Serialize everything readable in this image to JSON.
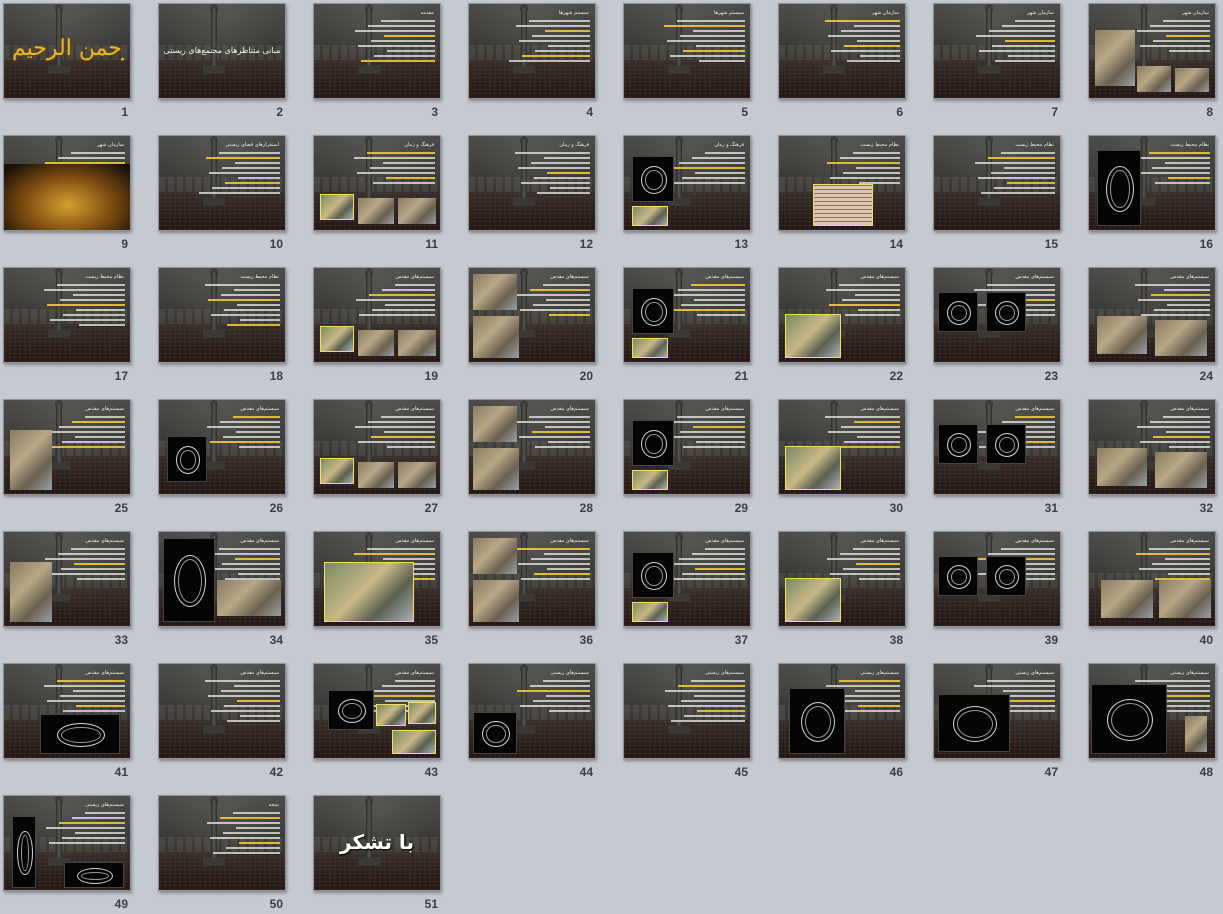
{
  "app": {
    "view": "slide-sorter"
  },
  "colors": {
    "background": "#c5c9d0",
    "slide_number": "#3b3e44",
    "accent_yellow": "#f0c83c",
    "calligraphy_gold": "#e7b634"
  },
  "slides": [
    {
      "number": "1",
      "kind": "calligraphy",
      "text": "بسم الله الرحمن الرحیم"
    },
    {
      "number": "2",
      "kind": "title",
      "text": "مبانی متناظرهای مجتمع‌های زیستی"
    },
    {
      "number": "3",
      "kind": "text",
      "title": "مقدمه"
    },
    {
      "number": "4",
      "kind": "text",
      "title": "سیستم شهرها"
    },
    {
      "number": "5",
      "kind": "text",
      "title": "سیستم شهرها"
    },
    {
      "number": "6",
      "kind": "text",
      "title": "سازمان شهر"
    },
    {
      "number": "7",
      "kind": "text",
      "title": "سازمان شهر"
    },
    {
      "number": "8",
      "kind": "image",
      "title": "سازمان شهر"
    },
    {
      "number": "9",
      "kind": "image",
      "title": "سازمان شهر"
    },
    {
      "number": "10",
      "kind": "text",
      "title": "استقرارهای فضای زیستی"
    },
    {
      "number": "11",
      "kind": "image",
      "title": "فرهنگ و زمان"
    },
    {
      "number": "12",
      "kind": "text",
      "title": "فرهنگ و زمان"
    },
    {
      "number": "13",
      "kind": "image",
      "title": "فرهنگ و زمان"
    },
    {
      "number": "14",
      "kind": "image",
      "title": "نظام محیط زیست"
    },
    {
      "number": "15",
      "kind": "text",
      "title": "نظام محیط زیست"
    },
    {
      "number": "16",
      "kind": "image",
      "title": "نظام محیط زیست"
    },
    {
      "number": "17",
      "kind": "text",
      "title": "نظام محیط زیست"
    },
    {
      "number": "18",
      "kind": "text",
      "title": "نظام محیط زیست"
    },
    {
      "number": "19",
      "kind": "image",
      "title": "سیستم‌های مقدس"
    },
    {
      "number": "20",
      "kind": "image",
      "title": "سیستم‌های مقدس"
    },
    {
      "number": "21",
      "kind": "image",
      "title": "سیستم‌های مقدس"
    },
    {
      "number": "22",
      "kind": "image",
      "title": "سیستم‌های مقدس"
    },
    {
      "number": "23",
      "kind": "image",
      "title": "سیستم‌های مقدس"
    },
    {
      "number": "24",
      "kind": "image",
      "title": "سیستم‌های مقدس"
    },
    {
      "number": "25",
      "kind": "image",
      "title": "سیستم‌های مقدس"
    },
    {
      "number": "26",
      "kind": "image",
      "title": "سیستم‌های مقدس"
    },
    {
      "number": "27",
      "kind": "image",
      "title": "سیستم‌های مقدس"
    },
    {
      "number": "28",
      "kind": "image",
      "title": "سیستم‌های مقدس"
    },
    {
      "number": "29",
      "kind": "image",
      "title": "سیستم‌های مقدس"
    },
    {
      "number": "30",
      "kind": "image",
      "title": "سیستم‌های مقدس"
    },
    {
      "number": "31",
      "kind": "image",
      "title": "سیستم‌های مقدس"
    },
    {
      "number": "32",
      "kind": "image",
      "title": "سیستم‌های مقدس"
    },
    {
      "number": "33",
      "kind": "image",
      "title": "سیستم‌های مقدس"
    },
    {
      "number": "34",
      "kind": "image",
      "title": "سیستم‌های مقدس"
    },
    {
      "number": "35",
      "kind": "image",
      "title": "سیستم‌های مقدس"
    },
    {
      "number": "36",
      "kind": "image",
      "title": "سیستم‌های مقدس"
    },
    {
      "number": "37",
      "kind": "image",
      "title": "سیستم‌های مقدس"
    },
    {
      "number": "38",
      "kind": "image",
      "title": "سیستم‌های مقدس"
    },
    {
      "number": "39",
      "kind": "image",
      "title": "سیستم‌های مقدس"
    },
    {
      "number": "40",
      "kind": "image",
      "title": "سیستم‌های مقدس"
    },
    {
      "number": "41",
      "kind": "image",
      "title": "سیستم‌های مقدس"
    },
    {
      "number": "42",
      "kind": "text",
      "title": "سیستم‌های مقدس"
    },
    {
      "number": "43",
      "kind": "image",
      "title": "سیستم‌های مقدس"
    },
    {
      "number": "44",
      "kind": "image",
      "title": "سیستم‌های زیستی"
    },
    {
      "number": "45",
      "kind": "text",
      "title": "سیستم‌های زیستی"
    },
    {
      "number": "46",
      "kind": "image",
      "title": "سیستم‌های زیستی"
    },
    {
      "number": "47",
      "kind": "image",
      "title": "سیستم‌های زیستی"
    },
    {
      "number": "48",
      "kind": "image",
      "title": "سیستم‌های زیستی"
    },
    {
      "number": "49",
      "kind": "image",
      "title": "سیستم‌های زیستی"
    },
    {
      "number": "50",
      "kind": "text",
      "title": "نتیجه"
    },
    {
      "number": "51",
      "kind": "thanks",
      "text": "با تشکر"
    }
  ]
}
